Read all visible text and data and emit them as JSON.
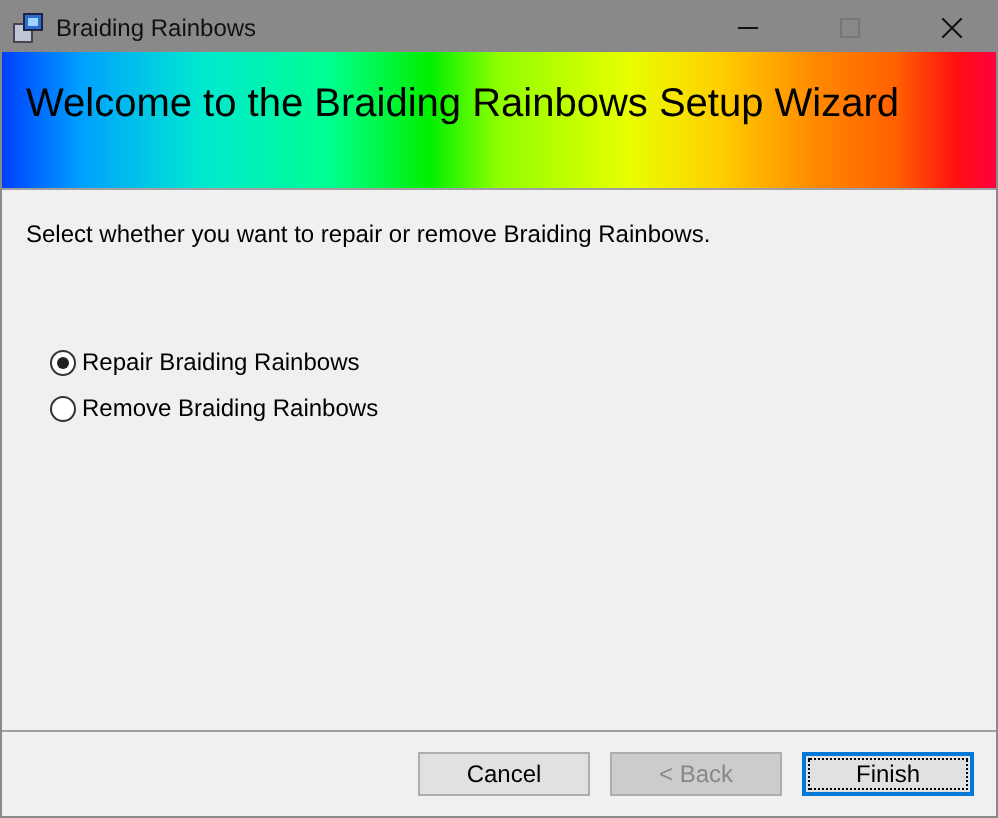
{
  "window": {
    "title": "Braiding Rainbows"
  },
  "banner": {
    "title": "Welcome to the Braiding Rainbows Setup Wizard"
  },
  "instruction": "Select whether you want to repair or remove Braiding Rainbows.",
  "options": [
    {
      "label": "Repair Braiding Rainbows",
      "selected": true
    },
    {
      "label": "Remove Braiding Rainbows",
      "selected": false
    }
  ],
  "buttons": [
    {
      "label": "Cancel",
      "disabled": false,
      "default": false
    },
    {
      "label": "< Back",
      "disabled": true,
      "default": false
    },
    {
      "label": "Finish",
      "disabled": false,
      "default": true
    }
  ]
}
